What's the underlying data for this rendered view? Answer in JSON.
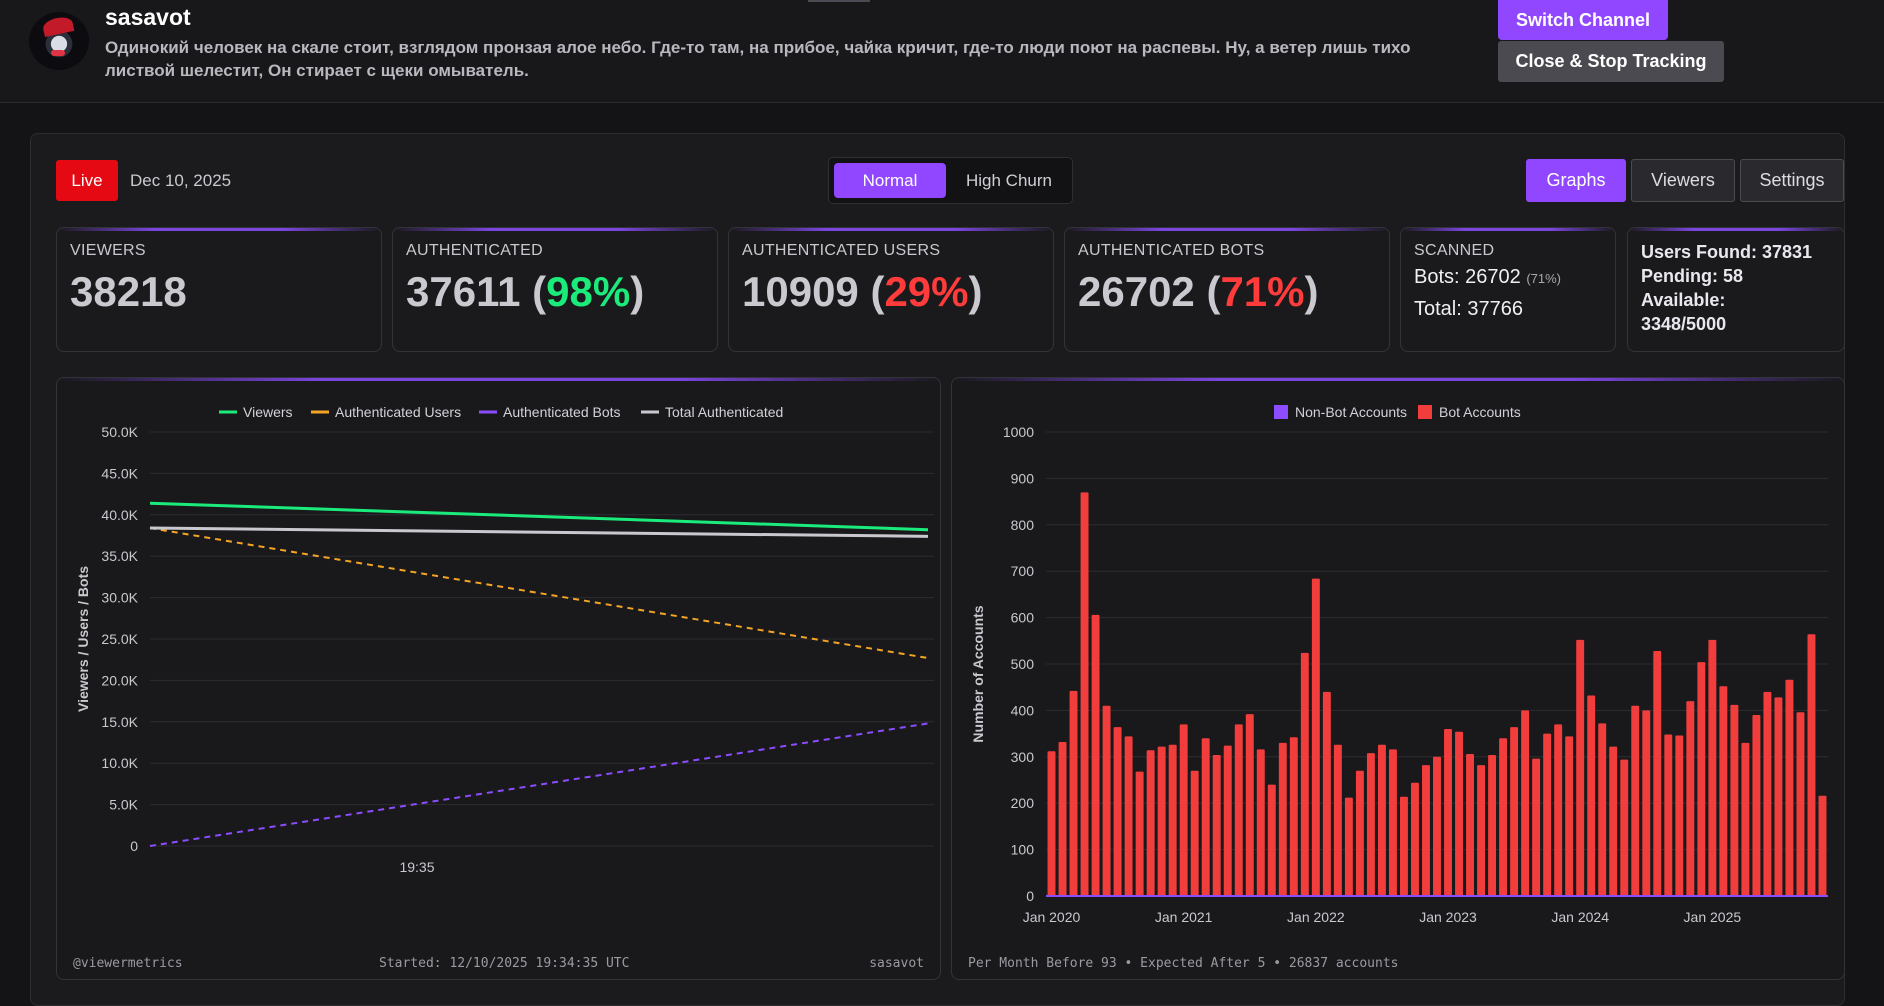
{
  "header": {
    "channel_name": "sasavot",
    "description": "Одинокий человек на скале стоит, взглядом пронзая алое небо. Где-то там, на прибое, чайка кричит, где-то люди поют на распевы. Ну, а ветер лишь тихо листвой шелестит, Он стирает с щеки омыватель.",
    "switch_label": "Switch Channel",
    "close_label": "Close & Stop Tracking"
  },
  "toolbar": {
    "live_label": "Live",
    "date": "Dec 10, 2025",
    "mode_normal": "Normal",
    "mode_high_churn": "High Churn",
    "nav_graphs": "Graphs",
    "nav_viewers": "Viewers",
    "nav_settings": "Settings"
  },
  "stats": {
    "viewers": {
      "label": "VIEWERS",
      "value": "38218"
    },
    "authenticated": {
      "label": "AUTHENTICATED",
      "value": "37611",
      "pct": "98%"
    },
    "auth_users": {
      "label": "AUTHENTICATED USERS",
      "value": "10909",
      "pct": "29%"
    },
    "auth_bots": {
      "label": "AUTHENTICATED BOTS",
      "value": "26702",
      "pct": "71%"
    },
    "scanned": {
      "label": "SCANNED",
      "bots_prefix": "Bots:",
      "bots": "26702",
      "bots_pct": "(71%)",
      "total_prefix": "Total:",
      "total": "37766"
    },
    "users_found": "Users Found: 37831",
    "pending": "Pending: 58",
    "available_label": "Available:",
    "available": "3348/5000"
  },
  "colors": {
    "accent": "#9147ff",
    "viewers": "#1aeb7a",
    "users": "#f5a524",
    "bots": "#8b4dff",
    "total": "#c8c8ce",
    "bot_bar": "#f23d3d",
    "live": "#e50914"
  },
  "chart_data": [
    {
      "type": "line",
      "ylabel": "Viewers / Users / Bots",
      "ylim": [
        0,
        50000
      ],
      "yticks": [
        "0",
        "5.0K",
        "10.0K",
        "15.0K",
        "20.0K",
        "25.0K",
        "30.0K",
        "35.0K",
        "40.0K",
        "45.0K",
        "50.0K"
      ],
      "x_tick_label": "19:35",
      "legend_position": "top",
      "grid": true,
      "series": [
        {
          "name": "Viewers",
          "color": "#1aeb7a",
          "dashed": false,
          "values": [
            41400,
            38200
          ]
        },
        {
          "name": "Authenticated Users",
          "color": "#f5a524",
          "dashed": true,
          "values": [
            38400,
            22700
          ]
        },
        {
          "name": "Authenticated Bots",
          "color": "#8b4dff",
          "dashed": true,
          "values": [
            0,
            14800
          ]
        },
        {
          "name": "Total Authenticated",
          "color": "#c8c8ce",
          "dashed": false,
          "values": [
            38400,
            37400
          ]
        }
      ],
      "footer": {
        "left": "@viewermetrics",
        "center": "Started: 12/10/2025 19:34:35 UTC",
        "right": "sasavot"
      }
    },
    {
      "type": "bar",
      "ylabel": "Number of Accounts",
      "ylim": [
        0,
        1000
      ],
      "yticks": [
        "0",
        "100",
        "200",
        "300",
        "400",
        "500",
        "600",
        "700",
        "800",
        "900",
        "1000"
      ],
      "x_tick_labels": [
        "Jan 2020",
        "Jan 2021",
        "Jan 2022",
        "Jan 2023",
        "Jan 2024",
        "Jan 2025"
      ],
      "legend_position": "top",
      "grid": true,
      "series": [
        {
          "name": "Non-Bot Accounts",
          "color": "#8b4dff",
          "values": []
        },
        {
          "name": "Bot Accounts",
          "color": "#f23d3d",
          "values": [
            312,
            332,
            442,
            870,
            606,
            410,
            364,
            344,
            268,
            314,
            322,
            326,
            370,
            270,
            340,
            304,
            324,
            370,
            392,
            316,
            240,
            330,
            342,
            524,
            684,
            440,
            326,
            212,
            270,
            308,
            326,
            316,
            214,
            244,
            282,
            300,
            360,
            354,
            306,
            282,
            304,
            340,
            364,
            400,
            296,
            350,
            370,
            344,
            552,
            432,
            372,
            322,
            294,
            410,
            400,
            528,
            348,
            346,
            420,
            504,
            552,
            452,
            412,
            330,
            390,
            440,
            428,
            466,
            396,
            564,
            216
          ]
        }
      ],
      "footer": "Per Month Before 93 • Expected After 5 • 26837 accounts"
    }
  ]
}
